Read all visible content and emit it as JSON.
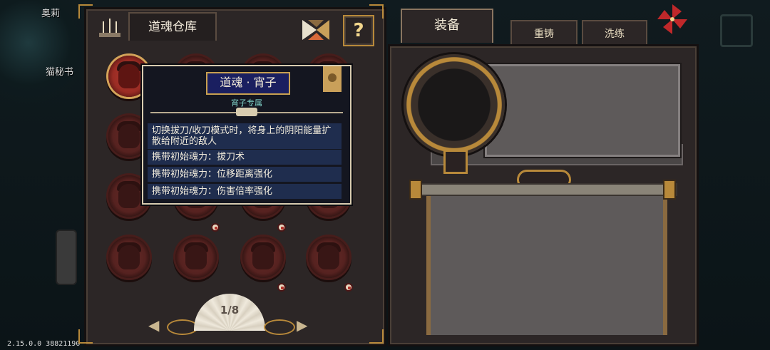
{
  "scene": {
    "npc_left_top": "奥莉",
    "npc_left_mid": "猫秘书",
    "version": "2.15.0.0 38821190"
  },
  "warehouse": {
    "title": "道魂仓库",
    "help_symbol": "?",
    "page_indicator": "1/8",
    "prev_symbol": "◀",
    "next_symbol": "▶"
  },
  "tooltip": {
    "title": "道魂 · 宵子",
    "subtitle": "宵子专属",
    "lines": [
      "切换拔刀/收刀模式时，将身上的阴阳能量扩散给附近的敌人",
      "携带初始魂力：拔刀术",
      "携带初始魂力：位移距离强化",
      "携带初始魂力：伤害倍率强化"
    ]
  },
  "tabs": {
    "equip": "装备",
    "recast": "重铸",
    "refine": "洗练"
  },
  "colors": {
    "panel": "#2c2626",
    "gold_trim": "#b8893a",
    "tooltip_bg": "#141620",
    "tooltip_title_bg": "#1a1f60",
    "subtitle": "#7fd1c8",
    "medal_active": "#b33a30",
    "medal_inactive": "#5a2220",
    "pinwheel": "#c0282a"
  },
  "icons": {
    "incense": "incense-icon",
    "tangram": "tangram-icon",
    "help": "question-mark-icon",
    "pinwheel": "pinwheel-icon",
    "fan": "folding-fan-icon"
  }
}
